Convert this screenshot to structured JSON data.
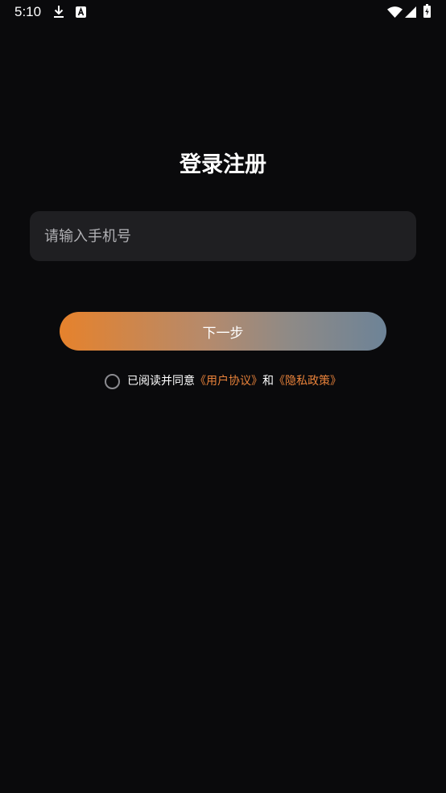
{
  "status_bar": {
    "time": "5:10",
    "icons": [
      "download-icon",
      "a-notification-icon",
      "wifi-icon",
      "signal-icon",
      "battery-icon"
    ]
  },
  "login": {
    "title": "登录注册",
    "phone_placeholder": "请输入手机号",
    "phone_value": "",
    "next_label": "下一步",
    "agreement_prefix": "已阅读并同意",
    "user_agreement": "《用户协议》",
    "and_text": "和",
    "privacy_policy": "《隐私政策》",
    "agreement_checked": false
  },
  "colors": {
    "background": "#0a0a0c",
    "input_background": "#1f1f22",
    "link": "#e8823a",
    "button_gradient_start": "#e6822c",
    "button_gradient_end": "#6d8397"
  }
}
